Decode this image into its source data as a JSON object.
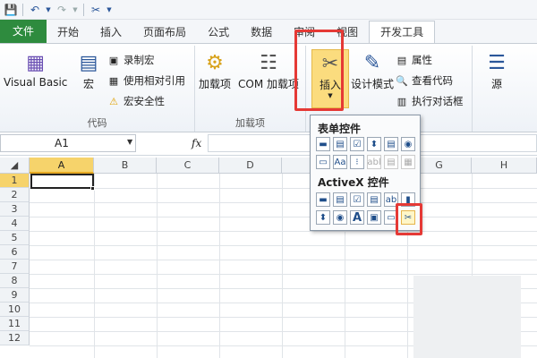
{
  "qat": {
    "icons": [
      "save-icon",
      "undo-icon",
      "redo-icon",
      "tools-icon"
    ]
  },
  "tabs": [
    {
      "label": "文件",
      "kind": "file"
    },
    {
      "label": "开始",
      "kind": ""
    },
    {
      "label": "插入",
      "kind": ""
    },
    {
      "label": "页面布局",
      "kind": ""
    },
    {
      "label": "公式",
      "kind": ""
    },
    {
      "label": "数据",
      "kind": ""
    },
    {
      "label": "审阅",
      "kind": ""
    },
    {
      "label": "视图",
      "kind": ""
    },
    {
      "label": "开发工具",
      "kind": "active"
    }
  ],
  "ribbon": {
    "code": {
      "label": "代码",
      "visual_basic": "Visual Basic",
      "macro": "宏",
      "record_macro": "录制宏",
      "relative_ref": "使用相对引用",
      "macro_security": "宏安全性"
    },
    "addins": {
      "label": "加载项",
      "addin": "加载项",
      "com_addin": "COM 加载项"
    },
    "controls": {
      "insert": "插入",
      "design_mode": "设计模式",
      "properties": "属性",
      "view_code": "查看代码",
      "run_dialog": "执行对话框"
    },
    "xml": {
      "source": "源"
    }
  },
  "formula_bar": {
    "name_box": "A1",
    "fx": "fx"
  },
  "grid": {
    "columns": [
      "A",
      "B",
      "C",
      "D",
      "E",
      "F",
      "G",
      "H"
    ],
    "rows": [
      "1",
      "2",
      "3",
      "4",
      "5",
      "6",
      "7",
      "8",
      "9",
      "10",
      "11",
      "12"
    ],
    "selected_cell": "A1"
  },
  "dropdown": {
    "form_controls_title": "表单控件",
    "activex_title": "ActiveX 控件",
    "form_row1": [
      "button-icon",
      "combobox-icon",
      "checkbox-icon",
      "spinner-icon",
      "listbox-icon",
      "option-icon"
    ],
    "form_row2": [
      "groupbox-icon",
      "label-icon",
      "scrollbar-icon",
      "textfield-icon",
      "combo-list-icon",
      "combo-drop-icon"
    ],
    "activex_row1": [
      "button-icon",
      "combobox-icon",
      "checkbox-icon",
      "listbox-icon",
      "textbox-icon",
      "scrollbar-icon"
    ],
    "activex_row2": [
      "spinner-icon",
      "option-icon",
      "label-icon",
      "image-icon",
      "toggle-icon",
      "more-controls-icon"
    ],
    "form_row1_glyphs": [
      "▬",
      "▤",
      "☑",
      "⬍",
      "▤",
      "◉"
    ],
    "form_row2_glyphs": [
      "▭",
      "Aa",
      "⁝",
      "abl",
      "▤",
      "▦"
    ],
    "activex_row1_glyphs": [
      "▬",
      "▤",
      "☑",
      "▤",
      "ab",
      "▮"
    ],
    "activex_row2_glyphs": [
      "⬍",
      "◉",
      "A",
      "▣",
      "▭",
      "✂"
    ]
  }
}
